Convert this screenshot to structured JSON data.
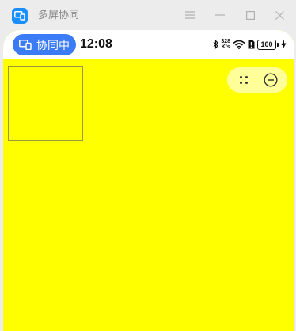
{
  "window": {
    "title": "多屏协同",
    "icon": "multi-screen-app-icon",
    "controls": [
      "menu-icon",
      "minimize-icon",
      "maximize-icon",
      "close-icon"
    ]
  },
  "statusbar": {
    "collab_label": "协同中",
    "time": "12:08",
    "net_speed_value": "328",
    "net_speed_unit": "K/s",
    "battery_level": "100"
  },
  "floating_controls": {
    "icons": [
      "drag-handle-icon",
      "exit-collab-icon"
    ]
  },
  "colors": {
    "phone_screen": "#ffff00",
    "collab_pill": "#3b7cf6",
    "app_icon": "#1a8fff",
    "titlebar": "#ececec"
  }
}
